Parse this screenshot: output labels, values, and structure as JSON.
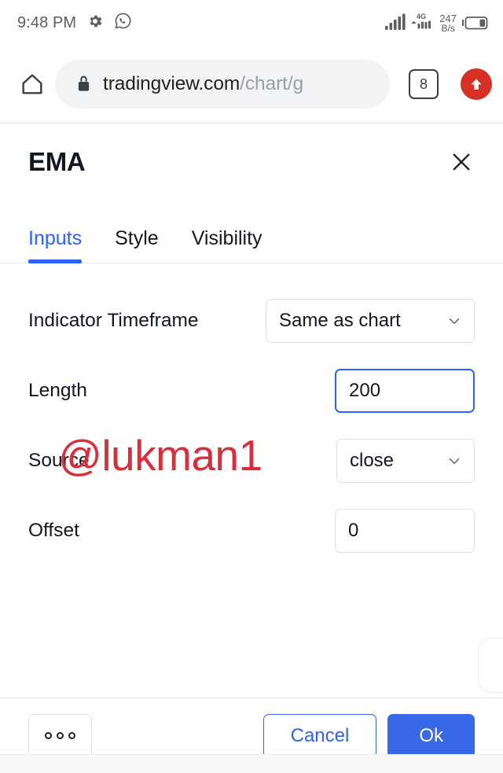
{
  "status_bar": {
    "time": "9:48 PM",
    "icons": [
      "gear-icon",
      "whatsapp-icon"
    ],
    "signal_icon": "signal-bars-icon",
    "network_type": "4G",
    "data_rate_value": "247",
    "data_rate_unit": "B/s",
    "battery_icon": "battery-icon"
  },
  "browser": {
    "home_icon": "home-icon",
    "lock_icon": "lock-icon",
    "url_visible": "tradingview.com",
    "url_path": "/chart/g",
    "tab_count": "8",
    "menu_fab_icon": "arrow-up-circle-icon"
  },
  "dialog": {
    "title": "EMA",
    "close_icon": "close-icon",
    "tabs": [
      {
        "label": "Inputs",
        "active": true
      },
      {
        "label": "Style",
        "active": false
      },
      {
        "label": "Visibility",
        "active": false
      }
    ],
    "fields": [
      {
        "label": "Indicator Timeframe",
        "control": "select",
        "value": "Same as chart",
        "chevron_icon": "chevron-down-icon"
      },
      {
        "label": "Length",
        "control": "input",
        "value": "200",
        "focused": true
      },
      {
        "label": "Source",
        "control": "select",
        "value": "close",
        "chevron_icon": "chevron-down-icon"
      },
      {
        "label": "Offset",
        "control": "input",
        "value": "0",
        "focused": false
      }
    ],
    "watermark": "@lukman1",
    "footer": {
      "more_icon": "more-horizontal-icon",
      "cancel_label": "Cancel",
      "ok_label": "Ok"
    }
  },
  "colors": {
    "accent_blue": "#2962ff",
    "ok_button": "#3668e8",
    "watermark_red": "#d92f3a",
    "fab_red": "#d93025"
  }
}
